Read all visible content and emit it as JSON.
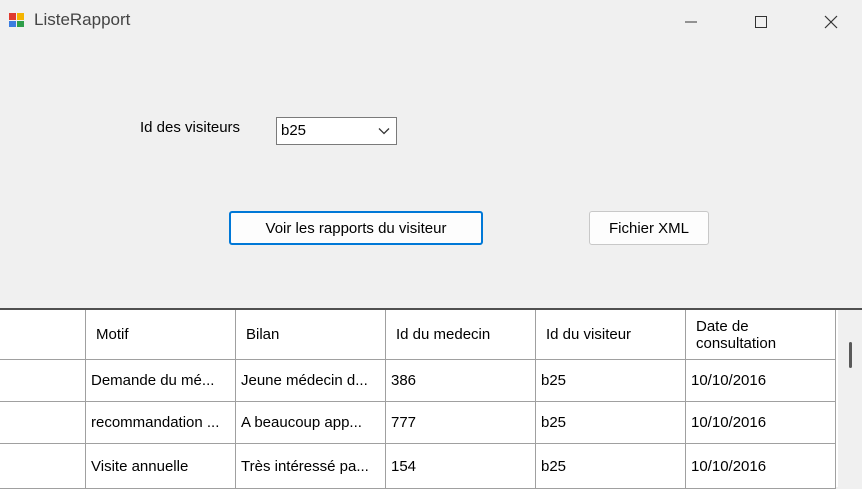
{
  "window": {
    "title": "ListeRapport"
  },
  "form": {
    "visitor_label": "Id des visiteurs",
    "visitor_select": {
      "value": "b25"
    },
    "view_button": "Voir les rapports du visiteur",
    "xml_button": "Fichier XML"
  },
  "grid": {
    "columns": [
      "Motif",
      "Bilan",
      "Id du medecin",
      "Id du visiteur",
      "Date de consultation"
    ],
    "rows": [
      [
        "Demande du mé...",
        "Jeune médecin d...",
        "386",
        "b25",
        "10/10/2016"
      ],
      [
        "recommandation ...",
        "A beaucoup app...",
        "777",
        "b25",
        "10/10/2016"
      ],
      [
        "Visite annuelle",
        "Très intéressé pa...",
        "154",
        "b25",
        "10/10/2016"
      ]
    ]
  }
}
